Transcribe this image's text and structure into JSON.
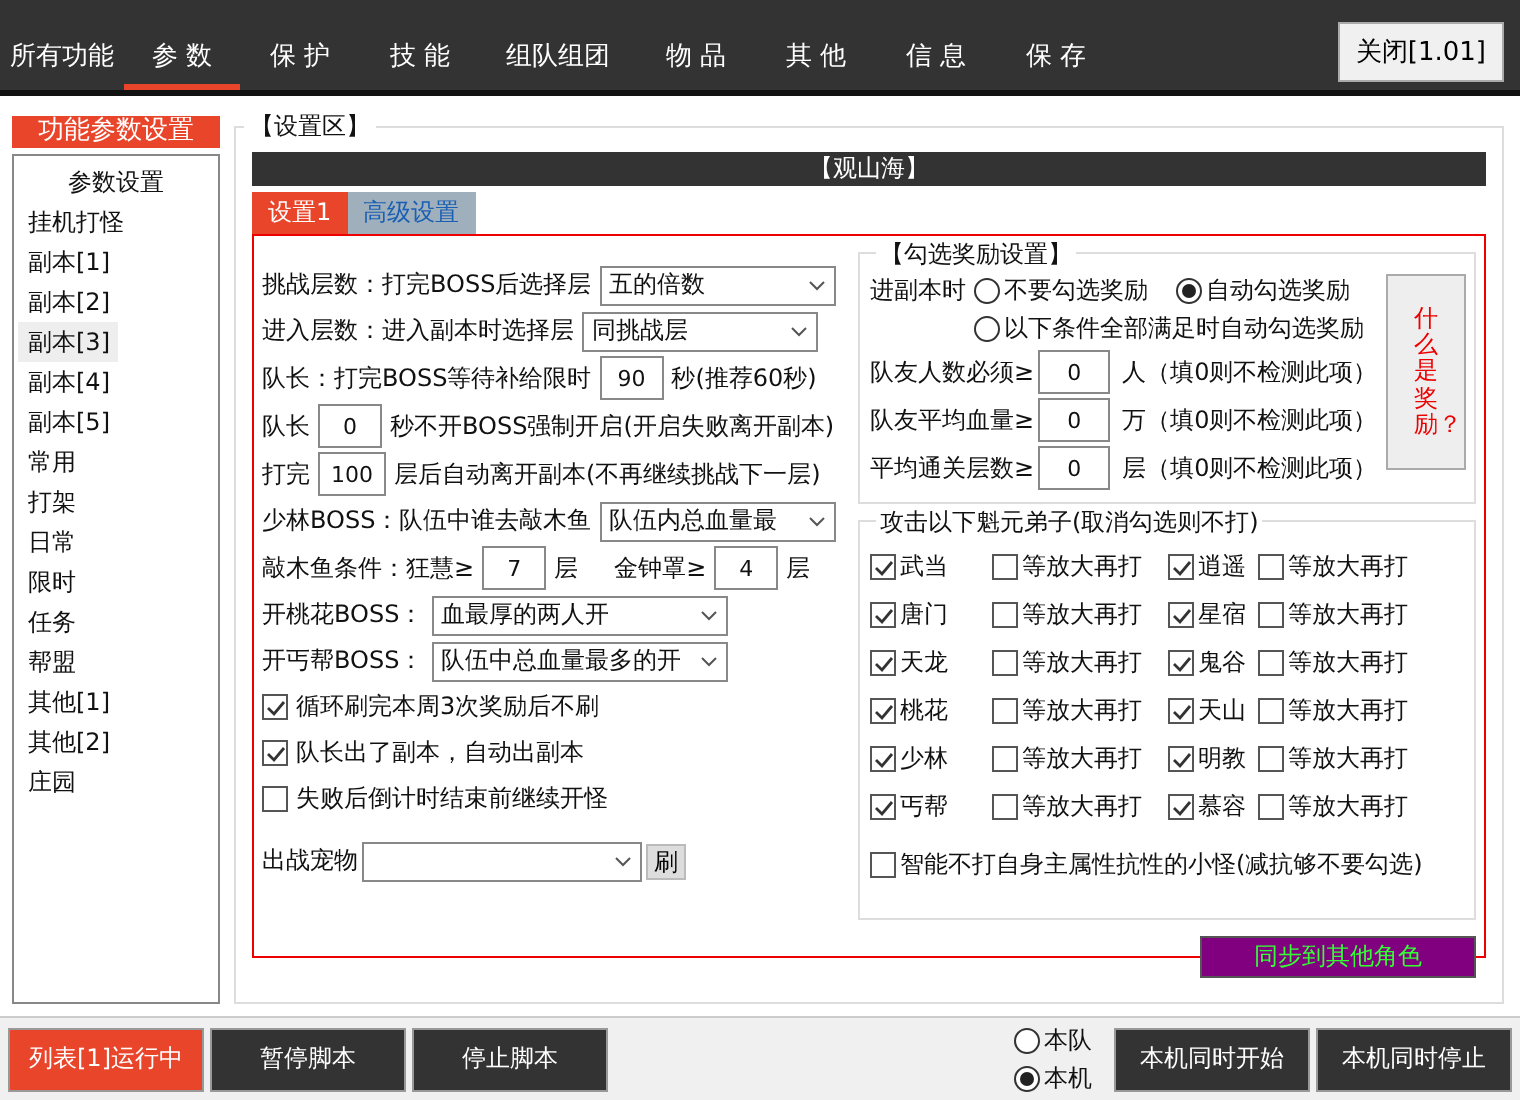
{
  "tabs": [
    {
      "label": "所有功能",
      "selected": false
    },
    {
      "label": "参 数",
      "selected": true
    },
    {
      "label": "保 护",
      "selected": false
    },
    {
      "label": "技 能",
      "selected": false
    },
    {
      "label": "组队组团",
      "selected": false
    },
    {
      "label": "物 品",
      "selected": false
    },
    {
      "label": "其 他",
      "selected": false
    },
    {
      "label": "信 息",
      "selected": false
    },
    {
      "label": "保 存",
      "selected": false
    }
  ],
  "close_button": "关闭[1.01]",
  "sidebar": {
    "title": "功能参数设置",
    "items": [
      {
        "label": "参数设置",
        "kind": "header",
        "selected": false
      },
      {
        "label": "挂机打怪",
        "kind": "item",
        "selected": false
      },
      {
        "label": "副本[1]",
        "kind": "item",
        "selected": false
      },
      {
        "label": "副本[2]",
        "kind": "item",
        "selected": false
      },
      {
        "label": "副本[3]",
        "kind": "item",
        "selected": true
      },
      {
        "label": "副本[4]",
        "kind": "item",
        "selected": false
      },
      {
        "label": "副本[5]",
        "kind": "item",
        "selected": false
      },
      {
        "label": "常用",
        "kind": "item",
        "selected": false
      },
      {
        "label": "打架",
        "kind": "item",
        "selected": false
      },
      {
        "label": "日常",
        "kind": "item",
        "selected": false
      },
      {
        "label": "限时",
        "kind": "item",
        "selected": false
      },
      {
        "label": "任务",
        "kind": "item",
        "selected": false
      },
      {
        "label": "帮盟",
        "kind": "item",
        "selected": false
      },
      {
        "label": "其他[1]",
        "kind": "item",
        "selected": false
      },
      {
        "label": "其他[2]",
        "kind": "item",
        "selected": false
      },
      {
        "label": "庄园",
        "kind": "item",
        "selected": false
      }
    ]
  },
  "settings": {
    "title": "【设置区】",
    "banner": "【观山海】",
    "subtabs": [
      {
        "label": "设置1",
        "selected": true
      },
      {
        "label": "高级设置",
        "selected": false
      }
    ],
    "form": [
      {
        "kind": "select",
        "label": "挑战层数：打完BOSS后选择层",
        "value": "五的倍数"
      },
      {
        "kind": "select",
        "label": "进入层数：进入副本时选择层",
        "value": "同挑战层"
      },
      {
        "kind": "fields",
        "segments": [
          {
            "kind": "text",
            "text": "队长：打完BOSS等待补给限时"
          },
          {
            "kind": "input",
            "text": "90"
          },
          {
            "kind": "text",
            "text": "秒(推荐60秒)"
          }
        ]
      },
      {
        "kind": "fields",
        "segments": [
          {
            "kind": "text",
            "text": "队长"
          },
          {
            "kind": "input",
            "text": "0"
          },
          {
            "kind": "text",
            "text": "秒不开BOSS强制开启(开启失败离开副本)"
          }
        ]
      },
      {
        "kind": "fields",
        "segments": [
          {
            "kind": "text",
            "text": "打完"
          },
          {
            "kind": "input",
            "text": "100"
          },
          {
            "kind": "text",
            "text": "层后自动离开副本(不再继续挑战下一层)"
          }
        ]
      },
      {
        "kind": "select",
        "label": "少林BOSS：队伍中谁去敲木鱼",
        "value": "队伍内总血量最"
      },
      {
        "kind": "fields",
        "segments": [
          {
            "kind": "text",
            "text": "敲木鱼条件：狂慧≥"
          },
          {
            "kind": "input",
            "text": "7"
          },
          {
            "kind": "text",
            "text": "层"
          },
          {
            "kind": "text",
            "text": "金钟罩≥"
          },
          {
            "kind": "input",
            "text": "4"
          },
          {
            "kind": "text",
            "text": "层"
          }
        ]
      },
      {
        "kind": "select",
        "label": "开桃花BOSS：",
        "value": "血最厚的两人开"
      },
      {
        "kind": "select",
        "label": "开丐帮BOSS：",
        "value": "队伍中总血量最多的开"
      },
      {
        "kind": "check",
        "label": "循环刷完本周3次奖励后不刷",
        "checked": true
      },
      {
        "kind": "check",
        "label": "队长出了副本，自动出副本",
        "checked": true
      },
      {
        "kind": "check",
        "label": "失败后倒计时结束前继续开怪",
        "checked": false
      },
      {
        "kind": "pet",
        "label": "出战宠物",
        "button": "刷"
      }
    ],
    "reward": {
      "title": "【勾选奖励设置】",
      "label": "进副本时",
      "radios": [
        {
          "label": "不要勾选奖励",
          "selected": false
        },
        {
          "label": "自动勾选奖励",
          "selected": true
        },
        {
          "label": "以下条件全部满足时自动勾选奖励",
          "selected": false
        }
      ],
      "rows": [
        {
          "label": "队友人数必须≥",
          "value": "0",
          "unit": "人（填0则不检测此项）"
        },
        {
          "label": "队友平均血量≥",
          "value": "0",
          "unit": "万（填0则不检测此项）"
        },
        {
          "label": "平均通关层数≥",
          "value": "0",
          "unit": "层（填0则不检测此项）"
        }
      ],
      "help_button": "什么是奖励？"
    },
    "attack": {
      "title": "攻击以下魁元弟子(取消勾选则不打)",
      "sects": [
        {
          "name": "武当",
          "checked": true,
          "wait": "等放大再打",
          "wait_checked": false
        },
        {
          "name": "逍遥",
          "checked": true,
          "wait": "等放大再打",
          "wait_checked": false
        },
        {
          "name": "唐门",
          "checked": true,
          "wait": "等放大再打",
          "wait_checked": false
        },
        {
          "name": "星宿",
          "checked": true,
          "wait": "等放大再打",
          "wait_checked": false
        },
        {
          "name": "天龙",
          "checked": true,
          "wait": "等放大再打",
          "wait_checked": false
        },
        {
          "name": "鬼谷",
          "checked": true,
          "wait": "等放大再打",
          "wait_checked": false
        },
        {
          "name": "桃花",
          "checked": true,
          "wait": "等放大再打",
          "wait_checked": false
        },
        {
          "name": "天山",
          "checked": true,
          "wait": "等放大再打",
          "wait_checked": false
        },
        {
          "name": "少林",
          "checked": true,
          "wait": "等放大再打",
          "wait_checked": false
        },
        {
          "name": "明教",
          "checked": true,
          "wait": "等放大再打",
          "wait_checked": false
        },
        {
          "name": "丐帮",
          "checked": true,
          "wait": "等放大再打",
          "wait_checked": false
        },
        {
          "name": "慕容",
          "checked": true,
          "wait": "等放大再打",
          "wait_checked": false
        }
      ],
      "smart": {
        "label": "智能不打自身主属性抗性的小怪(减抗够不要勾选)",
        "checked": false
      }
    },
    "sync_button": "同步到其他角色"
  },
  "footer": {
    "buttons": [
      {
        "label": "列表[1]运行中",
        "kind": "active"
      },
      {
        "label": "暂停脚本",
        "kind": "dark"
      },
      {
        "label": "停止脚本",
        "kind": "dark"
      }
    ],
    "radios": [
      {
        "label": "本队",
        "selected": false
      },
      {
        "label": "本机",
        "selected": true
      }
    ],
    "right_buttons": [
      "本机同时开始",
      "本机同时停止"
    ]
  }
}
